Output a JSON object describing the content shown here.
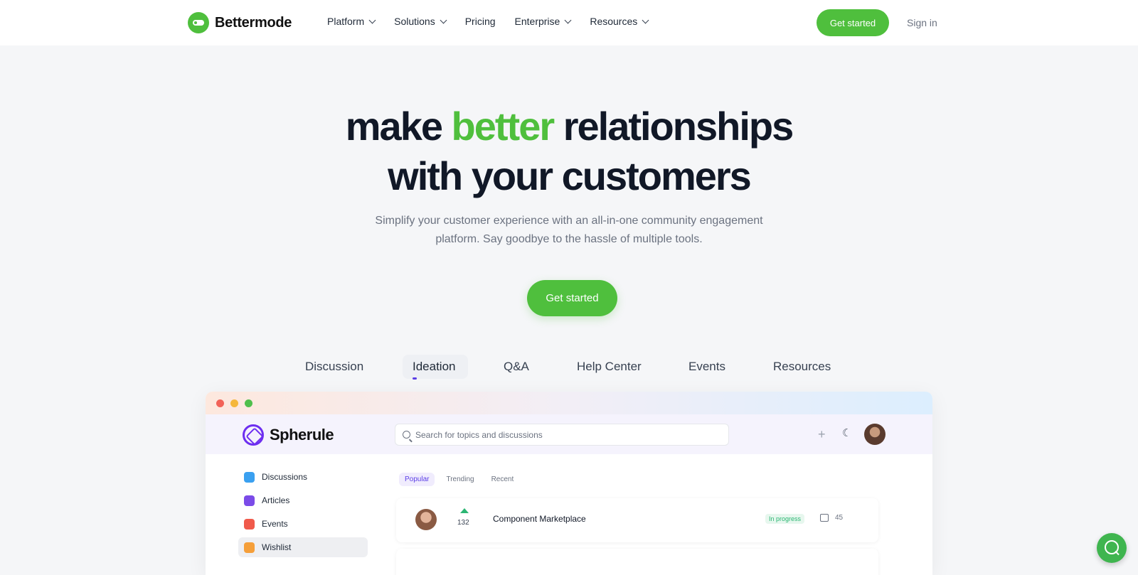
{
  "nav": {
    "brand": "Bettermode",
    "menu": [
      {
        "label": "Platform",
        "dropdown": true
      },
      {
        "label": "Solutions",
        "dropdown": true
      },
      {
        "label": "Pricing",
        "dropdown": false
      },
      {
        "label": "Enterprise",
        "dropdown": true
      },
      {
        "label": "Resources",
        "dropdown": true
      }
    ],
    "cta": "Get started",
    "sign_in": "Sign in"
  },
  "hero": {
    "title_part1": "make ",
    "title_accent": "better",
    "title_part2": " relationships",
    "title_line2": "with your customers",
    "subtitle_line1": "Simplify your customer experience with an all-in-one community engagement",
    "subtitle_line2": "platform. Say goodbye to the hassle of multiple tools.",
    "cta": "Get started"
  },
  "tabs": [
    "Discussion",
    "Ideation",
    "Q&A",
    "Help Center",
    "Events",
    "Resources"
  ],
  "active_tab": "Ideation",
  "colors": {
    "brand_green": "#4fbf3d",
    "accent_purple": "#5b3ee6"
  },
  "mock": {
    "brand": "Spherule",
    "search_placeholder": "Search for topics and discussions",
    "sidebar": [
      {
        "label": "Discussions",
        "color": "#3aa0f0"
      },
      {
        "label": "Articles",
        "color": "#7b4be8"
      },
      {
        "label": "Events",
        "color": "#f05a4b"
      },
      {
        "label": "Wishlist",
        "color": "#f59f3a"
      }
    ],
    "feed_tabs": [
      "Popular",
      "Trending",
      "Recent"
    ],
    "post": {
      "votes": "132",
      "title": "Component Marketplace",
      "status": "In progress",
      "comments": "45"
    }
  }
}
